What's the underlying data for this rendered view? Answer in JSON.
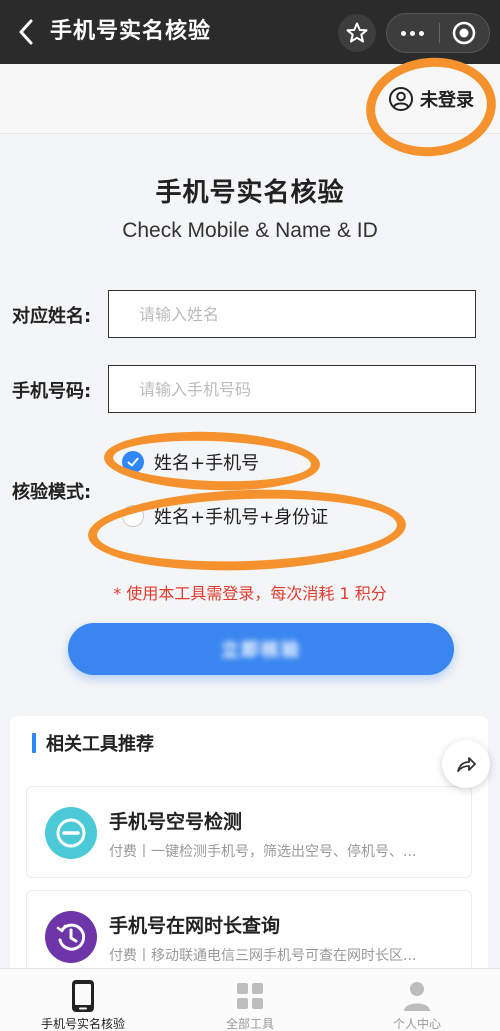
{
  "navbar": {
    "title": "手机号实名核验",
    "back_icon": "chevron-left-icon",
    "star_icon": "star-outline-icon",
    "more_icon": "more-dots-icon",
    "target_icon": "record-circle-icon"
  },
  "login": {
    "label": "未登录",
    "icon": "user-circle-icon"
  },
  "header": {
    "title": "手机号实名核验",
    "subtitle": "Check Mobile & Name & ID"
  },
  "form": {
    "name_label": "对应姓名:",
    "name_placeholder": "请输入姓名",
    "name_value": "",
    "phone_label": "手机号码:",
    "phone_placeholder": "请输入手机号码",
    "phone_value": "",
    "mode_label": "核验模式:",
    "modes": [
      {
        "label": "姓名+手机号",
        "selected": true
      },
      {
        "label": "姓名+手机号+身份证",
        "selected": false
      }
    ],
    "notice": "* 使用本工具需登录，每次消耗 1 积分",
    "submit_label": "立即核验"
  },
  "related": {
    "heading": "相关工具推荐",
    "tools": [
      {
        "name": "手机号空号检测",
        "desc": "付费丨一键检测手机号，筛选出空号、停机号、...",
        "icon": "minus-circle-icon",
        "color": "#4cc9d6"
      },
      {
        "name": "手机号在网时长查询",
        "desc": "付费丨移动联通电信三网手机号可查在网时长区...",
        "icon": "clock-history-icon",
        "color": "#6d35a8"
      }
    ]
  },
  "share_icon": "share-arrow-icon",
  "tabbar": {
    "items": [
      {
        "label": "手机号实名核验",
        "icon": "phone-icon",
        "active": true
      },
      {
        "label": "全部工具",
        "icon": "grid-icon",
        "active": false
      },
      {
        "label": "个人中心",
        "icon": "person-icon",
        "active": false
      }
    ]
  },
  "colors": {
    "accent": "#3a86f0",
    "notice": "#e23b2f",
    "annotation": "#f6922d",
    "navbar": "#2b2b2b"
  }
}
